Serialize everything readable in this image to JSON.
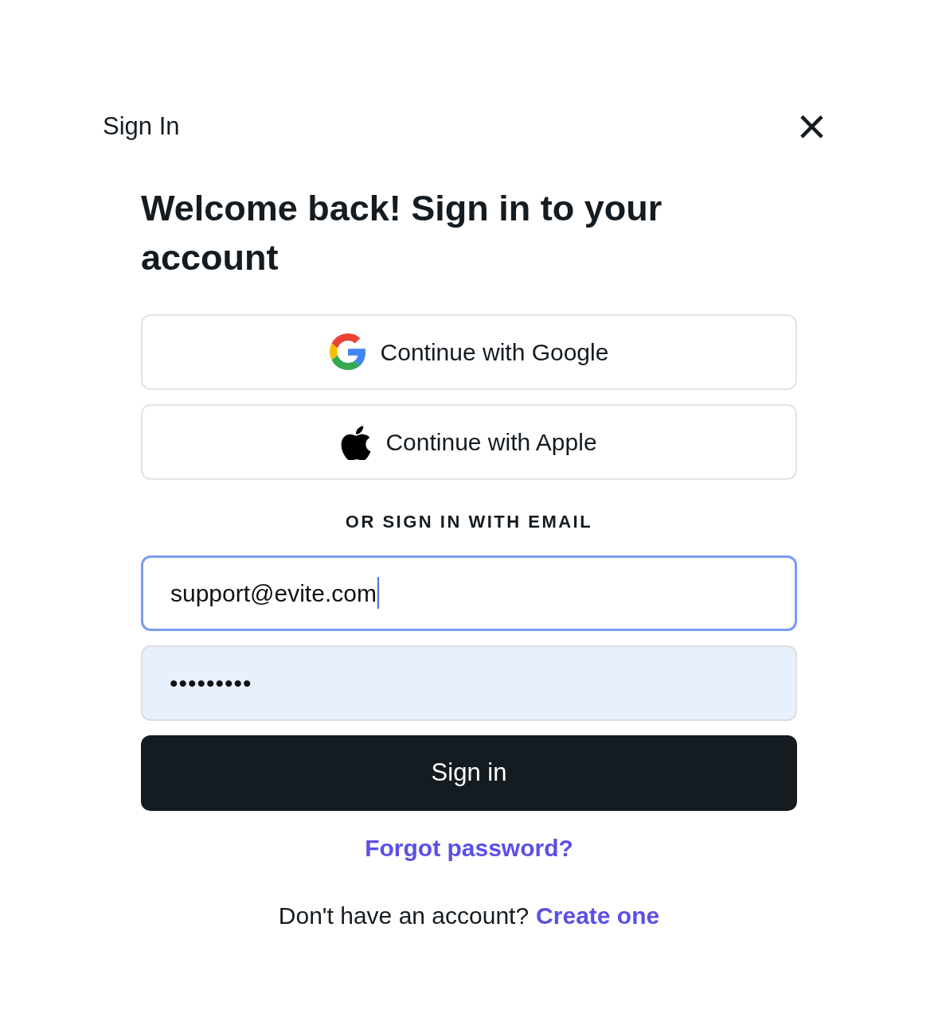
{
  "header": {
    "title": "Sign In",
    "close": "×"
  },
  "heading": "Welcome back! Sign in to your account",
  "social_buttons": [
    {
      "kind": "google",
      "label": "Continue with Google"
    },
    {
      "kind": "apple",
      "label": "Continue with Apple"
    }
  ],
  "divider": "OR SIGN IN WITH EMAIL",
  "email": {
    "value": "support@evite.com",
    "focused": true,
    "autofilled": false
  },
  "password": {
    "value": "•••••••••",
    "focused": false,
    "autofilled": true
  },
  "submit": "Sign in",
  "forgot": "Forgot password?",
  "signup": {
    "text": "Don't have an account?",
    "link": "Create one"
  }
}
